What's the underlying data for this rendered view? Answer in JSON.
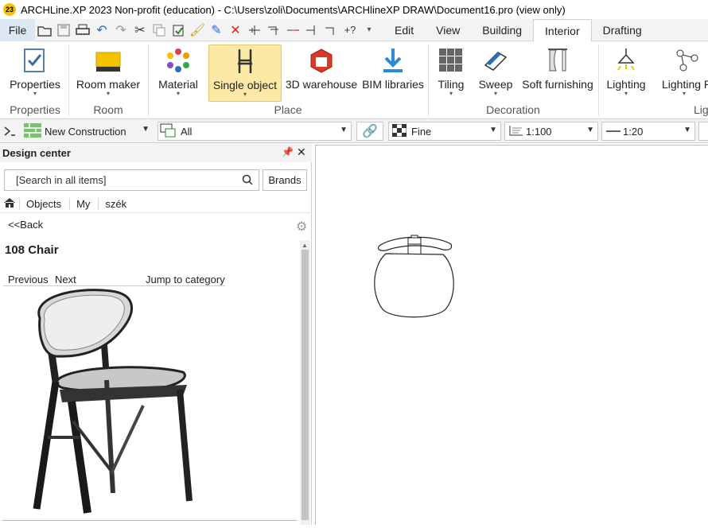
{
  "window": {
    "logo_text": "23",
    "title": "ARCHLine.XP 2023 Non-profit (education) - C:\\Users\\zoli\\Documents\\ARCHlineXP DRAW\\Document16.pro (view only)"
  },
  "menu": {
    "file": "File",
    "tabs": [
      "Edit",
      "View",
      "Building",
      "Interior",
      "Drafting"
    ],
    "active_tab": "Interior"
  },
  "ribbon": {
    "buttons": {
      "properties": "Properties",
      "room_maker": "Room maker",
      "material": "Material",
      "single_object": "Single object",
      "warehouse": "3D warehouse",
      "bim": "BIM libraries",
      "tiling": "Tiling",
      "sweep": "Sweep",
      "soft": "Soft furnishing",
      "lighting": "Lighting",
      "lighting_p": "Lighting P"
    },
    "groups": {
      "properties": "Properties",
      "room": "Room",
      "place": "Place",
      "decoration": "Decoration",
      "lig": "Lig"
    }
  },
  "propbar": {
    "layer": "New Construction",
    "filter": "All",
    "quality": "Fine",
    "scale": "1:100",
    "line_scale": "1:20"
  },
  "design_center": {
    "title": "Design center",
    "search_placeholder": "[Search in all items]",
    "brands": "Brands",
    "breadcrumb": [
      "Objects",
      "My",
      "szék"
    ],
    "back": "<<Back",
    "item_title": "108 Chair",
    "previous": "Previous",
    "next": "Next",
    "jump": "Jump to category"
  },
  "colors": {
    "accent": "#f3c300",
    "selected_bg": "#fde9a6",
    "link": "#e04040"
  }
}
